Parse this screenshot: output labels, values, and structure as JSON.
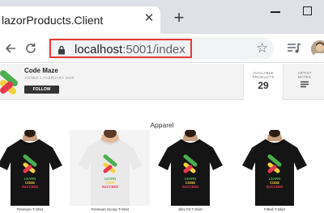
{
  "browser": {
    "tab_title": "lazorProducts.Client",
    "tab_close": "✕",
    "new_tab": "+",
    "url_host": "localhost",
    "url_rest": ":5001/index",
    "star": "☆"
  },
  "header": {
    "brand_name": "Code Maze",
    "joined": "JOINED 1 FEBRUARY 2020",
    "follow_label": "FOLLOW",
    "stats": {
      "available_label_line1": "AVAILABLE",
      "available_label_line2": "PRODUCTS",
      "available_value": "29",
      "notes_label_line1": "ARTIST",
      "notes_label_line2": "NOTES"
    }
  },
  "section": {
    "title": "Apparel"
  },
  "products": [
    {
      "name": "Premium T-Shirt",
      "shirt_color": "#151515"
    },
    {
      "name": "Premium Scoop T-Shirt",
      "shirt_color": "#e9e9e9"
    },
    {
      "name": "Slim Fit T-Shirt",
      "shirt_color": "#151515"
    },
    {
      "name": "Fitted T-Shirt",
      "shirt_color": "#151515"
    }
  ],
  "shirt_print": {
    "line1": "LEARN",
    "line2": "CODE",
    "line3": "SUCCEED"
  },
  "colors": {
    "accent_red": "#e53935",
    "logo_green": "#4caf50",
    "logo_yellow": "#f4d03f",
    "logo_red": "#e53950"
  }
}
